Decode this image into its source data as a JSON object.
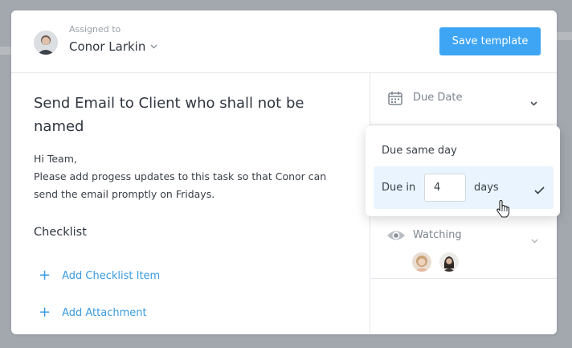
{
  "header": {
    "assigned_label": "Assigned to",
    "assignee_name": "Conor Larkin",
    "save_label": "Save template"
  },
  "task": {
    "title": "Send Email to Client who shall not be named",
    "description_lines": [
      "Hi Team,",
      "Please add progess updates to this task so that Conor can",
      "send the email promptly on Fridays."
    ]
  },
  "checklist": {
    "heading": "Checklist",
    "add_item_label": "Add Checklist Item",
    "add_attachment_label": "Add Attachment"
  },
  "sidebar": {
    "due_date_label": "Due Date",
    "watching_label": "Watching"
  },
  "due_popover": {
    "option_same_day": "Due same day",
    "option_due_in_prefix": "Due in",
    "days_value": "4",
    "option_due_in_suffix": "days"
  },
  "icons": [
    "chevron-down-icon",
    "calendar-icon",
    "eye-icon",
    "plus-icon",
    "check-icon",
    "hand-cursor-icon"
  ],
  "colors": {
    "accent": "#3ea5f5",
    "link": "#3a9be0",
    "selected_bg": "#e9f4fe",
    "overlay": "#a3a8ae"
  }
}
